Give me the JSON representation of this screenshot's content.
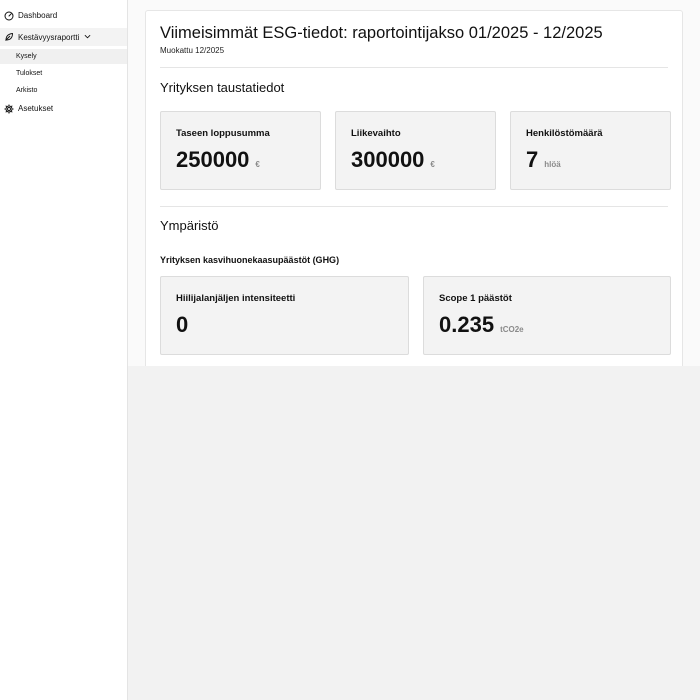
{
  "sidebar": {
    "items": [
      {
        "label": "Dashboard",
        "icon": "dashboard-gauge-icon"
      },
      {
        "label": "Kestävyysraportti",
        "icon": "leaf-report-icon",
        "expanded": true,
        "children": [
          {
            "label": "Kysely",
            "active": true
          },
          {
            "label": "Tulokset",
            "active": false
          },
          {
            "label": "Arkisto",
            "active": false
          }
        ]
      },
      {
        "label": "Asetukset",
        "icon": "gear-icon"
      }
    ]
  },
  "header": {
    "title": "Viimeisimmät ESG-tiedot: raportointijakso 01/2025 - 12/2025",
    "subtitle": "Muokattu 12/2025"
  },
  "background": {
    "title": "Yrityksen taustatiedot",
    "cards": [
      {
        "label": "Taseen loppusumma",
        "value": "250000",
        "unit": "€"
      },
      {
        "label": "Liikevaihto",
        "value": "300000",
        "unit": "€"
      },
      {
        "label": "Henkilöstömäärä",
        "value": "7",
        "unit": "hlöä"
      }
    ]
  },
  "environment": {
    "title": "Ympäristö",
    "ghg_title": "Yrityksen kasvihuonekaasupäästöt (GHG)",
    "cards": [
      {
        "label": "Hiilijalanjäljen intensiteetti",
        "value": "0",
        "unit": ""
      },
      {
        "label": "Scope 1 päästöt",
        "value": "0.235",
        "unit": "tCO2e"
      }
    ]
  }
}
